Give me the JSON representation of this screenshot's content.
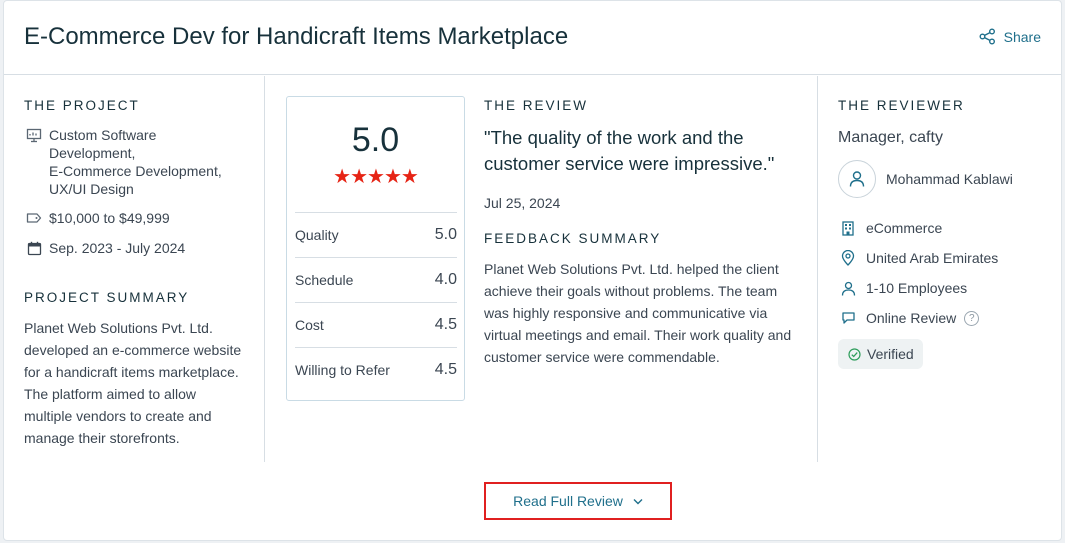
{
  "header": {
    "title": "E-Commerce Dev for Handicraft Items Marketplace",
    "share_label": "Share"
  },
  "project": {
    "section_label": "THE PROJECT",
    "services": [
      "Custom Software",
      "Development,",
      "E-Commerce Development,",
      "UX/UI Design"
    ],
    "budget": "$10,000 to $49,999",
    "dates": "Sep. 2023 - July 2024",
    "summary_label": "PROJECT SUMMARY",
    "summary_lines": [
      "Planet Web Solutions Pvt. Ltd.",
      "developed an e-commerce website",
      "for a handicraft items marketplace.",
      "The platform aimed to allow",
      "multiple vendors to create and",
      "manage their storefronts."
    ]
  },
  "ratings": {
    "overall": "5.0",
    "stars": "★★★★★",
    "rows": [
      {
        "label": "Quality",
        "value": "5.0"
      },
      {
        "label": "Schedule",
        "value": "4.0"
      },
      {
        "label": "Cost",
        "value": "4.5"
      },
      {
        "label": "Willing to Refer",
        "value": "4.5"
      }
    ]
  },
  "review": {
    "section_label": "THE REVIEW",
    "quote_lines": [
      "\"The quality of the work and the",
      "customer service were impressive.\""
    ],
    "date": "Jul 25, 2024",
    "feedback_label": "FEEDBACK SUMMARY",
    "feedback_lines": [
      "Planet Web Solutions Pvt. Ltd. helped the client",
      "achieve their goals without problems. The team",
      "was highly responsive and communicative via",
      "virtual meetings and email. Their work quality and",
      "customer service were commendable."
    ]
  },
  "reviewer": {
    "section_label": "THE REVIEWER",
    "title": "Manager, cafty",
    "name": "Mohammad Kablawi",
    "industry": "eCommerce",
    "location": "United Arab Emirates",
    "size": "1-10 Employees",
    "review_type": "Online Review",
    "help_mark": "?",
    "verified": "Verified"
  },
  "footer": {
    "read_full_label": "Read Full Review"
  },
  "colors": {
    "accent_link": "#1f6f8b",
    "star_red": "#e62415",
    "button_border": "#e02020",
    "verified_green": "#2e9d5b"
  }
}
